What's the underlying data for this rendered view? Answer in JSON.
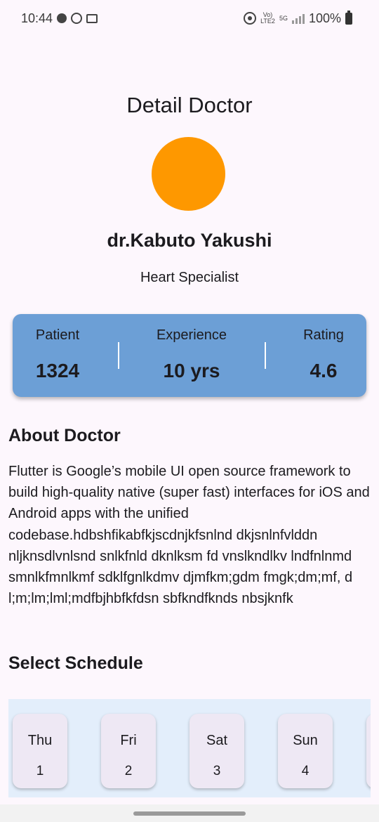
{
  "status_bar": {
    "time": "10:44",
    "battery": "100%",
    "volte_label": "Vo)",
    "lte_label": "LTE2",
    "network_label": "5G",
    "icons": [
      "notification-dot-icon",
      "whatsapp-icon",
      "news-icon",
      "hotspot-icon",
      "signal-icon",
      "battery-icon"
    ]
  },
  "header": {
    "title": "Detail Doctor"
  },
  "doctor": {
    "avatar_color": "#fe9800",
    "name": "dr.Kabuto Yakushi",
    "specialty": "Heart Specialist"
  },
  "stats": {
    "card_color": "#6c9fd6",
    "items": [
      {
        "label": "Patient",
        "value": "1324"
      },
      {
        "label": "Experience",
        "value": "10 yrs"
      },
      {
        "label": "Rating",
        "value": "4.6"
      }
    ]
  },
  "about": {
    "title": "About Doctor",
    "text": "Flutter is Google’s mobile UI open source framework to build high-quality native (super fast) interfaces for iOS and Android apps with the unified codebase.hdbshfikabfkjscdnjkfsnlnd dkjsnlnfvlddn nljknsdlvnlsnd snlkfnld dknlksm fd vnslkndlkv lndfnlnmd smnlkfmnlkmf sdklfgnlkdmv djmfkm;gdm fmgk;dm;mf, d l;m;lm;lml;mdfbjhbfkfdsn sbfkndfknds nbsjknfk"
  },
  "schedule": {
    "title": "Select Schedule",
    "strip_color": "#e3eefb",
    "days": [
      {
        "day": "Thu",
        "date": "1"
      },
      {
        "day": "Fri",
        "date": "2"
      },
      {
        "day": "Sat",
        "date": "3"
      },
      {
        "day": "Sun",
        "date": "4"
      },
      {
        "day": "",
        "date": ""
      }
    ]
  }
}
